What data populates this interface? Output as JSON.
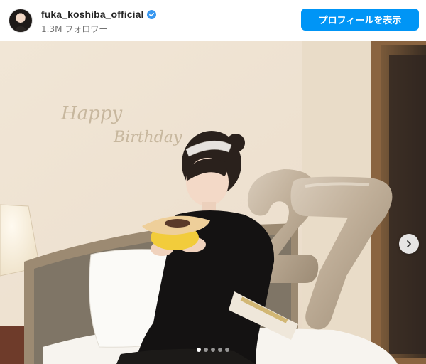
{
  "post_header": {
    "username": "fuka_koshiba_official",
    "verified": true,
    "followers_text": "1.3M フォロワー",
    "profile_button_label": "プロフィールを表示",
    "accent_color": "#0095f6",
    "verified_color": "#3897f0"
  },
  "photo": {
    "wall_text_line1": "Happy",
    "wall_text_line2": "Birthday",
    "balloon_number": "27",
    "icons": {
      "next": "chevron-right-icon",
      "verified": "verified-badge-icon"
    }
  },
  "carousel": {
    "total_slides": 5,
    "active_index": 0
  }
}
